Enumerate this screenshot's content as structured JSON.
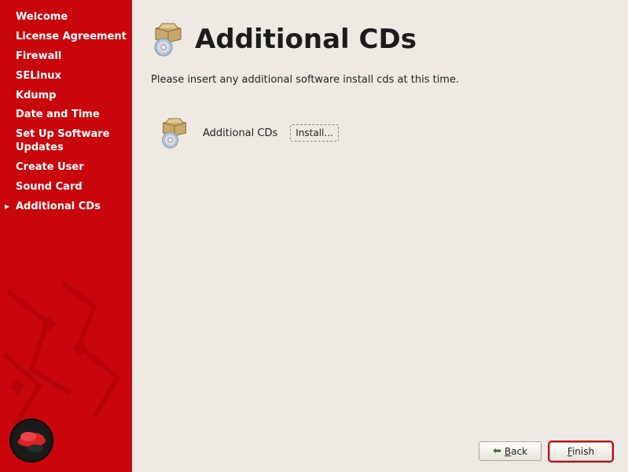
{
  "sidebar": {
    "items": [
      {
        "label": "Welcome"
      },
      {
        "label": "License Agreement"
      },
      {
        "label": "Firewall"
      },
      {
        "label": "SELinux"
      },
      {
        "label": "Kdump"
      },
      {
        "label": "Date and Time"
      },
      {
        "label": "Set Up Software Updates"
      },
      {
        "label": "Create User"
      },
      {
        "label": "Sound Card"
      },
      {
        "label": "Additional CDs"
      }
    ]
  },
  "page": {
    "title": "Additional CDs",
    "description": "Please insert any additional software install cds at this time."
  },
  "cd_row": {
    "label": "Additional CDs",
    "install_button": "Install..."
  },
  "footer": {
    "back_mnemonic": "B",
    "back_rest": "ack",
    "finish_mnemonic": "F",
    "finish_rest": "inish"
  }
}
